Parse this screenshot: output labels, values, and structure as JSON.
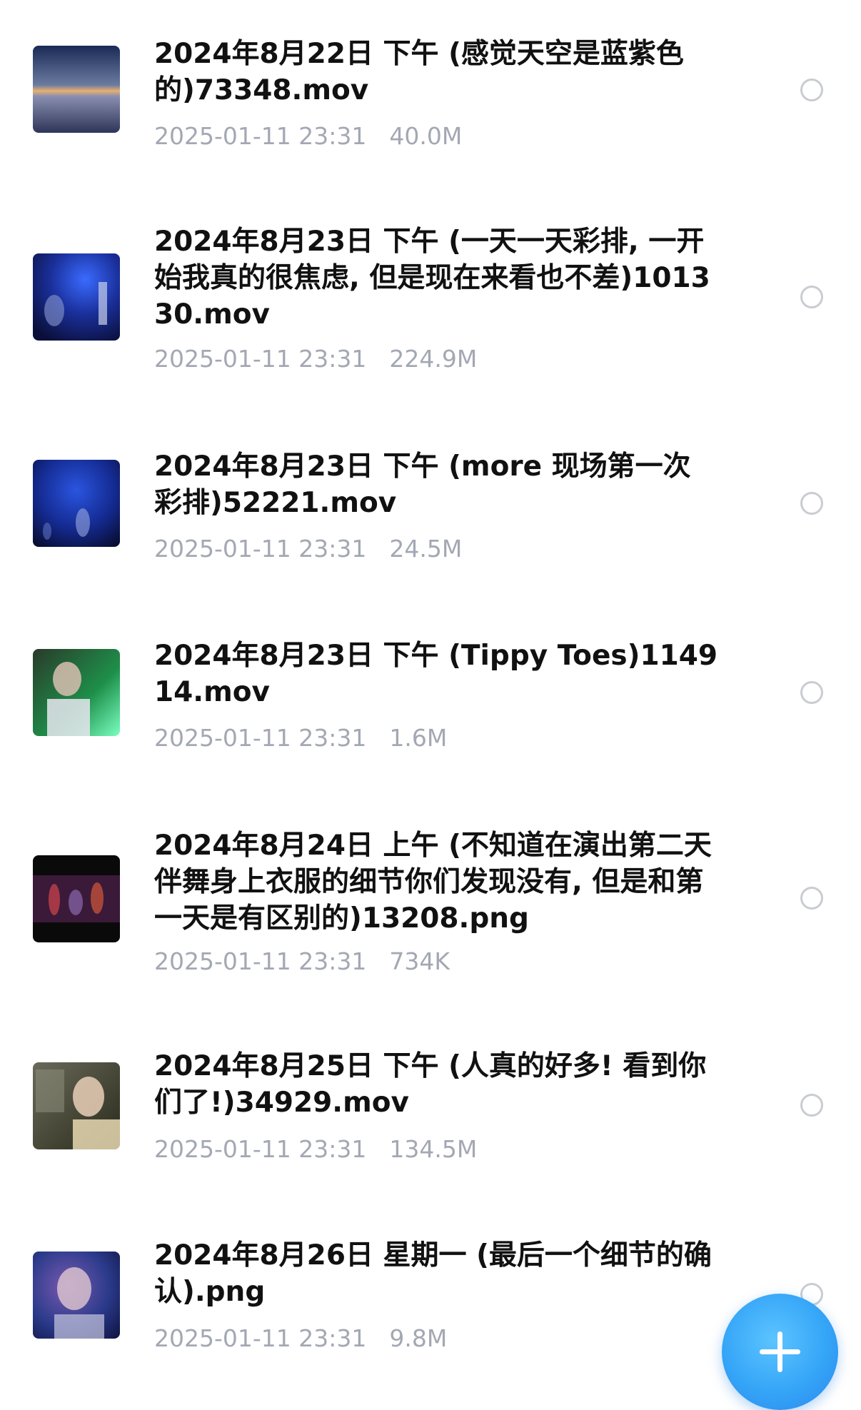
{
  "files": [
    {
      "name": "2024年8月22日 下午 (感觉天空是蓝紫色的)73348.mov",
      "date": "2025-01-11 23:31",
      "size": "40.0M",
      "thumbnail_colors": [
        "#1b2a55",
        "#c9a27a",
        "#2d3558"
      ]
    },
    {
      "name": "2024年8月23日 下午 (一天一天彩排, 一开始我真的很焦虑, 但是现在来看也不差)101330.mov",
      "date": "2025-01-11 23:31",
      "size": "224.9M",
      "thumbnail_colors": [
        "#0b1660",
        "#2a4bd8",
        "#0a0f3a"
      ]
    },
    {
      "name": "2024年8月23日 下午 (more 现场第一次彩排)52221.mov",
      "date": "2025-01-11 23:31",
      "size": "24.5M",
      "thumbnail_colors": [
        "#0a1240",
        "#1c3fb8",
        "#070b2a"
      ]
    },
    {
      "name": "2024年8月23日 下午 (Tippy Toes)114914.mov",
      "date": "2025-01-11 23:31",
      "size": "1.6M",
      "thumbnail_colors": [
        "#2a6b3a",
        "#c8d9c2",
        "#1e8f4a"
      ]
    },
    {
      "name": "2024年8月24日 上午 (不知道在演出第二天伴舞身上衣服的细节你们发现没有, 但是和第一天是有区别的)13208.png",
      "date": "2025-01-11 23:31",
      "size": "734K",
      "thumbnail_colors": [
        "#0a0a0a",
        "#8a2a3a",
        "#2a1a40"
      ]
    },
    {
      "name": "2024年8月25日 下午 (人真的好多! 看到你们了!)34929.mov",
      "date": "2025-01-11 23:31",
      "size": "134.5M",
      "thumbnail_colors": [
        "#5a5a4a",
        "#d8c8a8",
        "#3a3a2a"
      ]
    },
    {
      "name": "2024年8月26日 星期一 (最后一个细节的确认).png",
      "date": "2025-01-11 23:31",
      "size": "9.8M",
      "thumbnail_colors": [
        "#12184a",
        "#7a5ab0",
        "#1a2a6a"
      ]
    }
  ],
  "fab": {
    "icon": "plus-icon",
    "color": "#35a5f7"
  }
}
